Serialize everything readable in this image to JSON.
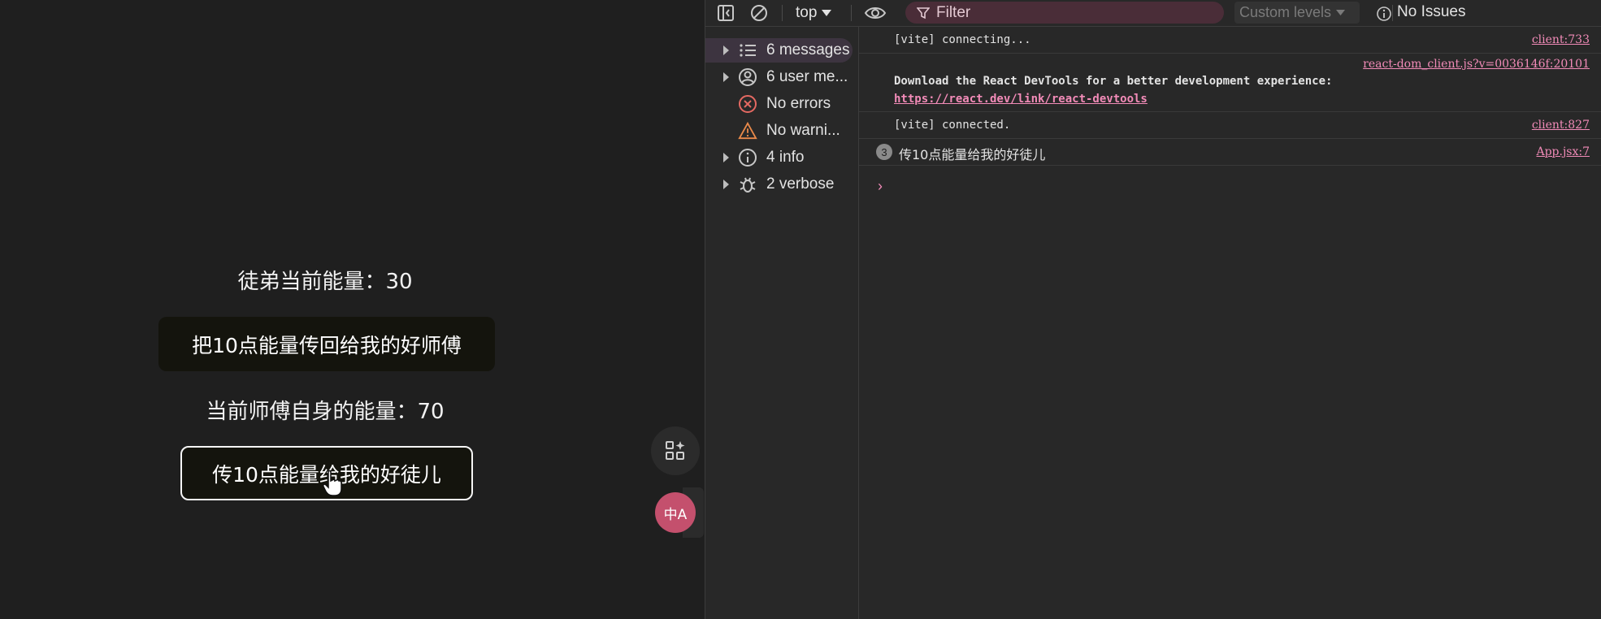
{
  "app": {
    "disciple_energy": "徒弟当前能量：30",
    "return_button": "把10点能量传回给我的好师傅",
    "master_energy": "当前师傅自身的能量：70",
    "give_button": "传10点能量给我的好徒儿",
    "translate_label": "中A"
  },
  "devtools": {
    "toolbar": {
      "context": "top",
      "filter_placeholder": "Filter",
      "levels": "Custom levels",
      "issues": "No Issues"
    },
    "sidebar": [
      {
        "label": "6 messages",
        "icon": "list-icon",
        "expandable": true,
        "selected": true
      },
      {
        "label": "6 user me...",
        "icon": "user-icon",
        "expandable": true,
        "selected": false
      },
      {
        "label": "No errors",
        "icon": "error-icon",
        "expandable": false,
        "selected": false
      },
      {
        "label": "No warni...",
        "icon": "warning-icon",
        "expandable": false,
        "selected": false
      },
      {
        "label": "4 info",
        "icon": "info-icon",
        "expandable": true,
        "selected": false
      },
      {
        "label": "2 verbose",
        "icon": "bug-icon",
        "expandable": true,
        "selected": false
      }
    ],
    "logs": [
      {
        "text": "[vite] connecting...",
        "source": "client:733"
      },
      {
        "source": "react-dom_client.js?v=0036146f:20101",
        "text": "Download the React DevTools for a better development experience:",
        "link": "https://react.dev/link/react-devtools"
      },
      {
        "text": "[vite] connected.",
        "source": "client:827"
      },
      {
        "count": "3",
        "text": "传10点能量给我的好徒儿",
        "source": "App.jsx:7"
      }
    ],
    "prompt": "›"
  },
  "colors": {
    "app_bg": "#1f1f1f",
    "devtools_bg": "#282828",
    "link_pink": "#f28bb8",
    "filter_bg": "#4a2d38",
    "translate_bg": "#c4506d"
  }
}
